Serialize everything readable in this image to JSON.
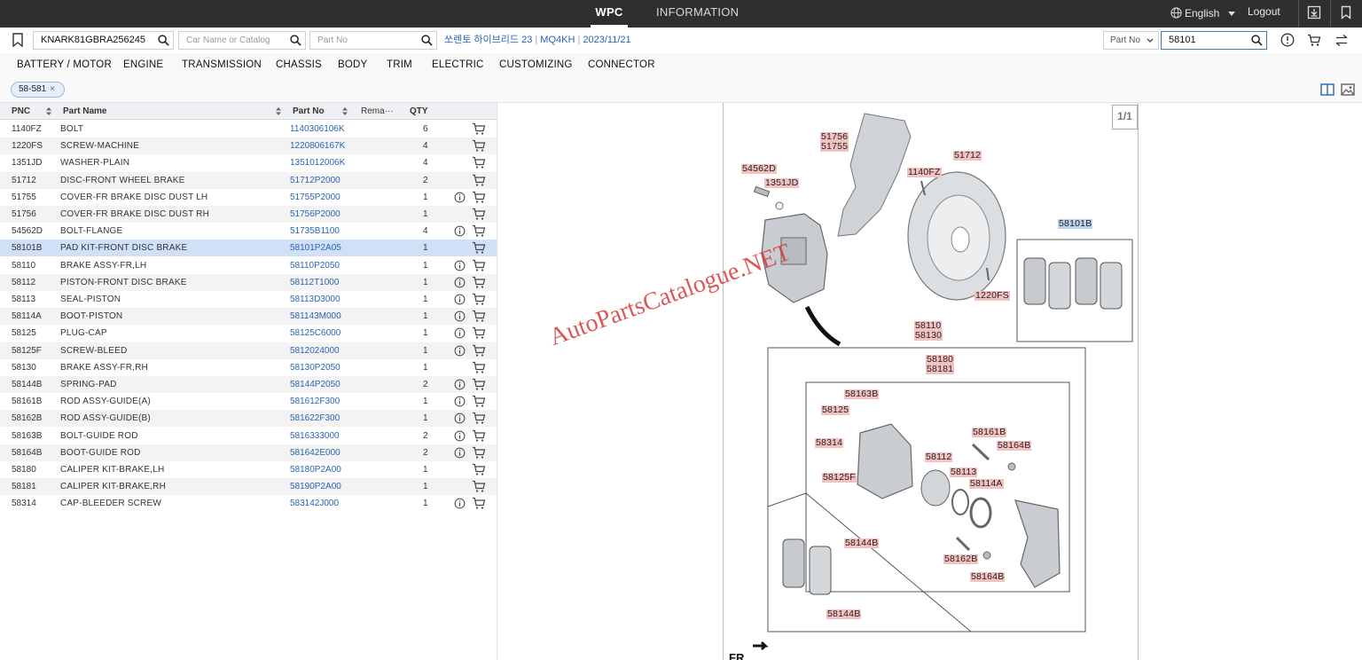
{
  "topbar": {
    "tabs": [
      "WPC",
      "INFORMATION"
    ],
    "language": "English",
    "logout": "Logout"
  },
  "search": {
    "vin": "KNARK81GBRA256245",
    "car_placeholder": "Car Name or Catalog",
    "part_placeholder": "Part No",
    "vehicle_name": "쏘렌토 하이브리드 23",
    "model_code": "MQ4KH",
    "date": "2023/11/21",
    "mode_select": "Part No",
    "query": "58101"
  },
  "categories": [
    "BATTERY / MOTOR",
    "ENGINE",
    "TRANSMISSION",
    "CHASSIS",
    "BODY",
    "TRIM",
    "ELECTRIC",
    "CUSTOMIZING",
    "CONNECTOR"
  ],
  "filter_chip": "58-581",
  "table": {
    "headers": {
      "pnc": "PNC",
      "name": "Part Name",
      "no": "Part No",
      "remark": "Rema···",
      "qty": "QTY"
    },
    "rows": [
      {
        "pnc": "1140FZ",
        "name": "BOLT",
        "no": "1140306106K",
        "qty": "6",
        "info": false
      },
      {
        "pnc": "1220FS",
        "name": "SCREW-MACHINE",
        "no": "1220806167K",
        "qty": "4",
        "info": false
      },
      {
        "pnc": "1351JD",
        "name": "WASHER-PLAIN",
        "no": "1351012006K",
        "qty": "4",
        "info": false
      },
      {
        "pnc": "51712",
        "name": "DISC-FRONT WHEEL BRAKE",
        "no": "51712P2000",
        "qty": "2",
        "info": false
      },
      {
        "pnc": "51755",
        "name": "COVER-FR BRAKE DISC DUST LH",
        "no": "51755P2000",
        "qty": "1",
        "info": true
      },
      {
        "pnc": "51756",
        "name": "COVER-FR BRAKE DISC DUST RH",
        "no": "51756P2000",
        "qty": "1",
        "info": false
      },
      {
        "pnc": "54562D",
        "name": "BOLT-FLANGE",
        "no": "51735B1100",
        "qty": "4",
        "info": true
      },
      {
        "pnc": "58101B",
        "name": "PAD KIT-FRONT DISC BRAKE",
        "no": "58101P2A05",
        "qty": "1",
        "info": false,
        "selected": true
      },
      {
        "pnc": "58110",
        "name": "BRAKE ASSY-FR,LH",
        "no": "58110P2050",
        "qty": "1",
        "info": true
      },
      {
        "pnc": "58112",
        "name": "PISTON-FRONT DISC BRAKE",
        "no": "58112T1000",
        "qty": "1",
        "info": true
      },
      {
        "pnc": "58113",
        "name": "SEAL-PISTON",
        "no": "58113D3000",
        "qty": "1",
        "info": true
      },
      {
        "pnc": "58114A",
        "name": "BOOT-PISTON",
        "no": "581143M000",
        "qty": "1",
        "info": true
      },
      {
        "pnc": "58125",
        "name": "PLUG-CAP",
        "no": "58125C6000",
        "qty": "1",
        "info": true
      },
      {
        "pnc": "58125F",
        "name": "SCREW-BLEED",
        "no": "5812024000",
        "qty": "1",
        "info": true
      },
      {
        "pnc": "58130",
        "name": "BRAKE ASSY-FR,RH",
        "no": "58130P2050",
        "qty": "1",
        "info": false
      },
      {
        "pnc": "58144B",
        "name": "SPRING-PAD",
        "no": "58144P2050",
        "qty": "2",
        "info": true
      },
      {
        "pnc": "58161B",
        "name": "ROD ASSY-GUIDE(A)",
        "no": "581612F300",
        "qty": "1",
        "info": true
      },
      {
        "pnc": "58162B",
        "name": "ROD ASSY-GUIDE(B)",
        "no": "581622F300",
        "qty": "1",
        "info": true
      },
      {
        "pnc": "58163B",
        "name": "BOLT-GUIDE ROD",
        "no": "5816333000",
        "qty": "2",
        "info": true
      },
      {
        "pnc": "58164B",
        "name": "BOOT-GUIDE ROD",
        "no": "581642E000",
        "qty": "2",
        "info": true
      },
      {
        "pnc": "58180",
        "name": "CALIPER KIT-BRAKE,LH",
        "no": "58180P2A00",
        "qty": "1",
        "info": false
      },
      {
        "pnc": "58181",
        "name": "CALIPER KIT-BRAKE,RH",
        "no": "58190P2A00",
        "qty": "1",
        "info": false
      },
      {
        "pnc": "58314",
        "name": "CAP-BLEEDER SCREW",
        "no": "583142J000",
        "qty": "1",
        "info": true
      }
    ]
  },
  "diagram": {
    "pager": "1/1",
    "watermark": "AutoPartsCatalogue.NET",
    "fr_label": "FR",
    "labels": [
      "51756",
      "51755",
      "54562D",
      "1351JD",
      "1140FZ",
      "51712",
      "58101B",
      "1220FS",
      "58110",
      "58130",
      "58180",
      "58181",
      "58163B",
      "58125",
      "58314",
      "58125F",
      "58161B",
      "58164B",
      "58112",
      "58113",
      "58114A",
      "58144B",
      "58162B",
      "58164B",
      "58144B"
    ]
  }
}
